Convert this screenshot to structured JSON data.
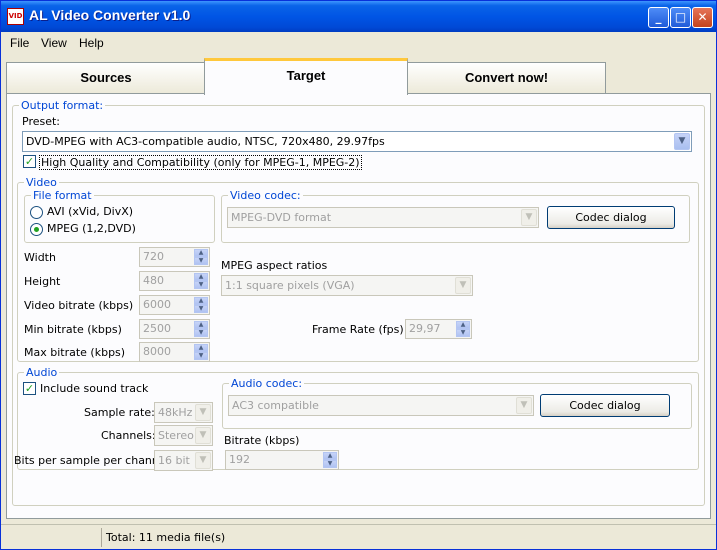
{
  "window": {
    "title": "AL Video Converter v1.0",
    "icon_text": "VID",
    "min_glyph": "_",
    "max_glyph": "□",
    "close_glyph": "✕"
  },
  "menu": [
    "File",
    "View",
    "Help"
  ],
  "tabs": [
    "Sources",
    "Target",
    "Convert now!"
  ],
  "output_format": {
    "legend": "Output format:",
    "preset_label": "Preset:",
    "preset_value": "DVD-MPEG with AC3-compatible audio, NTSC, 720x480, 29.97fps",
    "hq_label": "High Quality and Compatibility (only for MPEG-1, MPEG-2)"
  },
  "video": {
    "legend": "Video",
    "file_format_legend": "File format",
    "avi_label": "AVI (xVid, DivX)",
    "mpeg_label": "MPEG (1,2,DVD)",
    "codec_legend": "Video codec:",
    "codec_value": "MPEG-DVD format",
    "codec_button": "Codec dialog",
    "aspect_label": "MPEG aspect ratios",
    "aspect_value": "1:1 square pixels (VGA)",
    "width_label": "Width",
    "width_value": "720",
    "height_label": "Height",
    "height_value": "480",
    "bitrate_label": "Video bitrate (kbps)",
    "bitrate_value": "6000",
    "min_bitrate_label": "Min bitrate (kbps)",
    "min_bitrate_value": "2500",
    "max_bitrate_label": "Max bitrate (kbps)",
    "max_bitrate_value": "8000",
    "framerate_label": "Frame Rate (fps)",
    "framerate_value": "29,97"
  },
  "audio": {
    "legend": "Audio",
    "include_label": "Include sound track",
    "samplerate_label": "Sample rate:",
    "samplerate_value": "48kHz",
    "channels_label": "Channels:",
    "channels_value": "Stereo",
    "bits_label": "Bits per sample per channel:",
    "bits_value": "16 bit",
    "codec_legend": "Audio codec:",
    "codec_value": "AC3 compatible",
    "codec_button": "Codec dialog",
    "bitrate_label": "Bitrate (kbps)",
    "bitrate_value": "192"
  },
  "status": {
    "total": "Total: 11 media file(s)"
  }
}
